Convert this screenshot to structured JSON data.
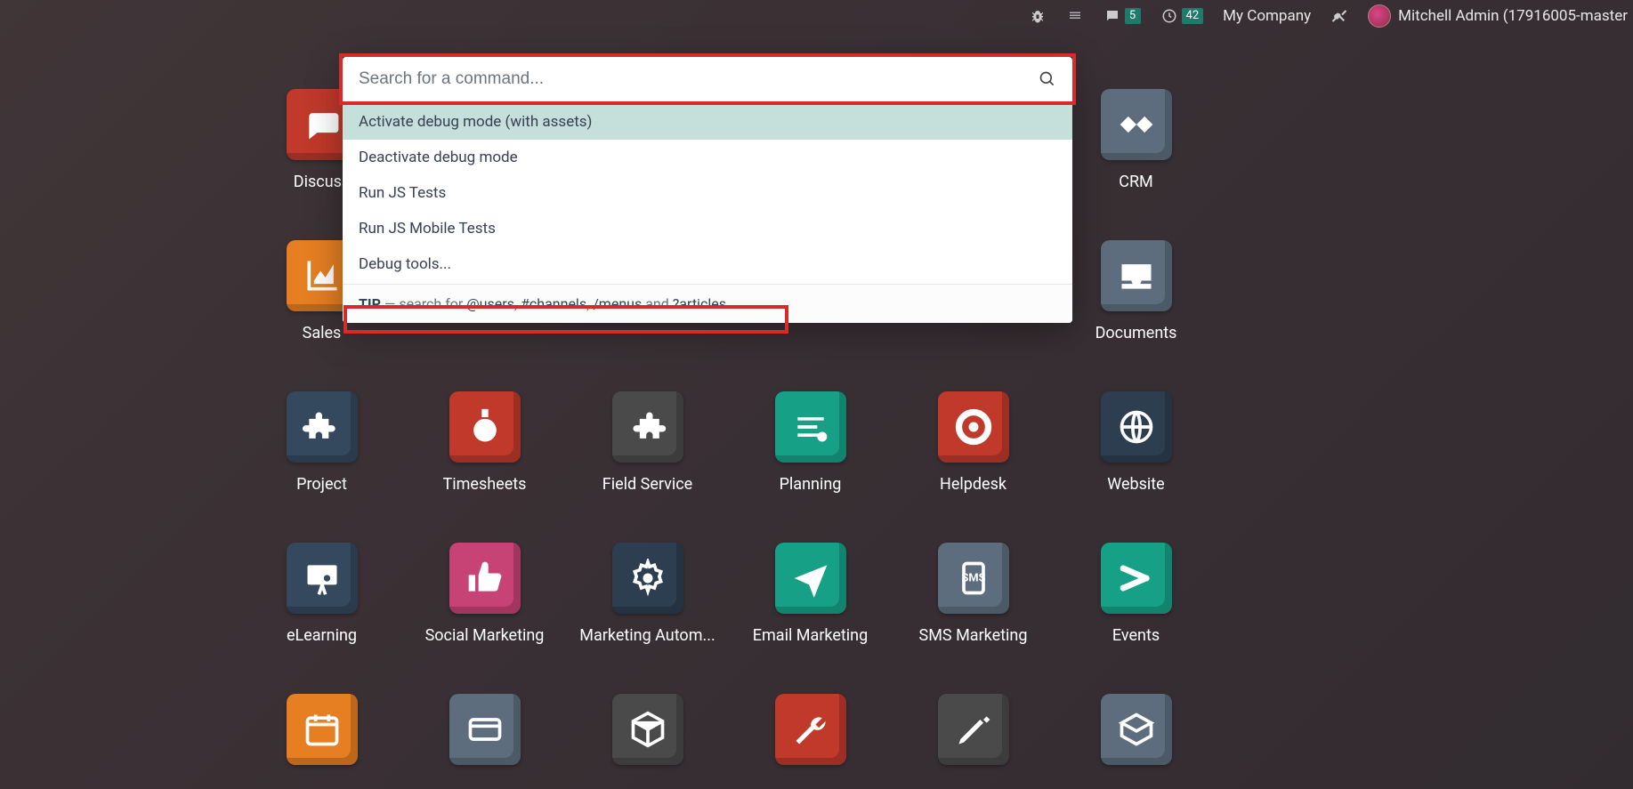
{
  "topbar": {
    "messages_badge": "5",
    "activities_badge": "42",
    "company_label": "My Company",
    "user_label": "Mitchell Admin (17916005-master"
  },
  "palette": {
    "search_placeholder": "Search for a command...",
    "items": [
      "Activate debug mode (with assets)",
      "Deactivate debug mode",
      "Run JS Tests",
      "Run JS Mobile Tests",
      "Debug tools..."
    ],
    "tip_label": "TIP",
    "tip_sep": " — search for ",
    "tip_users": "@users",
    "tip_c1": ", ",
    "tip_channels": "#channels",
    "tip_c2": ", ",
    "tip_menus": "/menus",
    "tip_and": " and ",
    "tip_articles": "?articles"
  },
  "apps": [
    {
      "label": "Discuss",
      "color": "#c0392b",
      "icon": "chat"
    },
    {
      "label": "",
      "color": "",
      "icon": ""
    },
    {
      "label": "",
      "color": "",
      "icon": ""
    },
    {
      "label": "",
      "color": "",
      "icon": ""
    },
    {
      "label": "",
      "color": "",
      "icon": ""
    },
    {
      "label": "CRM",
      "color": "#5d6d7e",
      "icon": "hands"
    },
    {
      "label": "Sales",
      "color": "#e67e22",
      "icon": "chart"
    },
    {
      "label": "",
      "color": "",
      "icon": ""
    },
    {
      "label": "",
      "color": "",
      "icon": ""
    },
    {
      "label": "",
      "color": "",
      "icon": ""
    },
    {
      "label": "",
      "color": "",
      "icon": ""
    },
    {
      "label": "Documents",
      "color": "#5d6d7e",
      "icon": "inbox"
    },
    {
      "label": "Project",
      "color": "#34495e",
      "icon": "puzzle"
    },
    {
      "label": "Timesheets",
      "color": "#c0392b",
      "icon": "stopwatch"
    },
    {
      "label": "Field Service",
      "color": "#4a4a4a",
      "icon": "puzzle2"
    },
    {
      "label": "Planning",
      "color": "#16a085",
      "icon": "lines"
    },
    {
      "label": "Helpdesk",
      "color": "#c0392b",
      "icon": "lifebuoy"
    },
    {
      "label": "Website",
      "color": "#2c3e50",
      "icon": "globe"
    },
    {
      "label": "eLearning",
      "color": "#34495e",
      "icon": "board"
    },
    {
      "label": "Social Marketing",
      "color": "#c74375",
      "icon": "thumb"
    },
    {
      "label": "Marketing Autom...",
      "color": "#2c3e50",
      "icon": "gear"
    },
    {
      "label": "Email Marketing",
      "color": "#16a085",
      "icon": "plane"
    },
    {
      "label": "SMS Marketing",
      "color": "#5d6d7e",
      "icon": "sms"
    },
    {
      "label": "Events",
      "color": "#16a085",
      "icon": "ticket"
    },
    {
      "label": "",
      "color": "#e67e22",
      "icon": "cal"
    },
    {
      "label": "",
      "color": "#5d6d7e",
      "icon": "card"
    },
    {
      "label": "",
      "color": "#4a4a4a",
      "icon": "box"
    },
    {
      "label": "",
      "color": "#c0392b",
      "icon": "wrench"
    },
    {
      "label": "",
      "color": "#4a4a4a",
      "icon": "pencil"
    },
    {
      "label": "",
      "color": "#5d6d7e",
      "icon": "box2"
    }
  ]
}
